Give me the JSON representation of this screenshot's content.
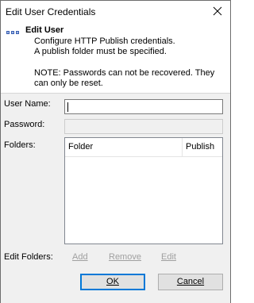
{
  "window": {
    "title": "Edit User Credentials"
  },
  "icons": {
    "close": "close-icon",
    "header": "network-icon"
  },
  "header": {
    "title": "Edit User",
    "description_line1": "Configure HTTP Publish credentials.",
    "description_line2": "A publish folder must be specified.",
    "note_line1": "NOTE: Passwords can not be recovered. They",
    "note_line2": "can only be reset."
  },
  "form": {
    "username_label": "User Name:",
    "username_value": "",
    "password_label": "Password:",
    "password_value": "",
    "folders_label": "Folders:"
  },
  "folders_table": {
    "columns": [
      "Folder",
      "Publish"
    ],
    "rows": []
  },
  "edit_folders": {
    "label": "Edit Folders:",
    "add": "Add",
    "remove": "Remove",
    "edit": "Edit"
  },
  "buttons": {
    "ok": "OK",
    "cancel": "Cancel"
  },
  "colors": {
    "content_background": "#f0f0f0",
    "disabled_text": "#a0a0a0",
    "default_button_border": "#0078d7",
    "header_icon": "#3a5fb0"
  }
}
